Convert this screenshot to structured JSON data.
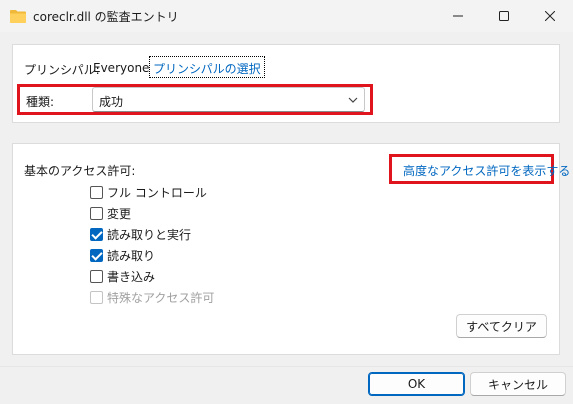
{
  "window": {
    "title": "coreclr.dll の監査エントリ",
    "icon": "folder-icon",
    "controls": [
      "minimize-icon",
      "maximize-icon",
      "close-icon"
    ]
  },
  "principal": {
    "label": "プリンシパル:",
    "value": "Everyone",
    "select_link": "プリンシパルの選択"
  },
  "type": {
    "label": "種類:",
    "selected": "成功"
  },
  "basic_permissions": {
    "label": "基本のアクセス許可:",
    "advanced_link": "高度なアクセス許可を表示する",
    "items": [
      {
        "label": "フル コントロール",
        "checked": false,
        "disabled": false
      },
      {
        "label": "変更",
        "checked": false,
        "disabled": false
      },
      {
        "label": "読み取りと実行",
        "checked": true,
        "disabled": false
      },
      {
        "label": "読み取り",
        "checked": true,
        "disabled": false
      },
      {
        "label": "書き込み",
        "checked": false,
        "disabled": false
      },
      {
        "label": "特殊なアクセス許可",
        "checked": false,
        "disabled": true
      }
    ],
    "clear_all": "すべてクリア"
  },
  "footer": {
    "ok": "OK",
    "cancel": "キャンセル"
  },
  "colors": {
    "accent": "#0067c0",
    "highlight": "#e0141c",
    "folder": "#f0b93a"
  }
}
